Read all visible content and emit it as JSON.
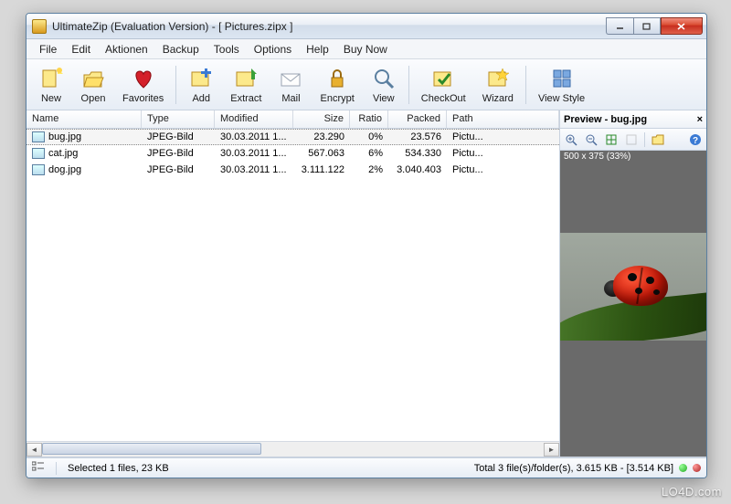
{
  "title": "UltimateZip (Evaluation Version) - [ Pictures.zipx ]",
  "menu": [
    "File",
    "Edit",
    "Aktionen",
    "Backup",
    "Tools",
    "Options",
    "Help",
    "Buy Now"
  ],
  "toolbar": [
    {
      "id": "new",
      "label": "New"
    },
    {
      "id": "open",
      "label": "Open"
    },
    {
      "id": "favorites",
      "label": "Favorites"
    },
    {
      "id": "add",
      "label": "Add"
    },
    {
      "id": "extract",
      "label": "Extract"
    },
    {
      "id": "mail",
      "label": "Mail"
    },
    {
      "id": "encrypt",
      "label": "Encrypt"
    },
    {
      "id": "view",
      "label": "View"
    },
    {
      "id": "checkout",
      "label": "CheckOut"
    },
    {
      "id": "wizard",
      "label": "Wizard"
    },
    {
      "id": "viewstyle",
      "label": "View Style"
    }
  ],
  "columns": {
    "name": "Name",
    "type": "Type",
    "modified": "Modified",
    "size": "Size",
    "ratio": "Ratio",
    "packed": "Packed",
    "path": "Path"
  },
  "files": [
    {
      "name": "bug.jpg",
      "type": "JPEG-Bild",
      "modified": "30.03.2011 1...",
      "size": "23.290",
      "ratio": "0%",
      "packed": "23.576",
      "path": "Pictu...",
      "selected": true
    },
    {
      "name": "cat.jpg",
      "type": "JPEG-Bild",
      "modified": "30.03.2011 1...",
      "size": "567.063",
      "ratio": "6%",
      "packed": "534.330",
      "path": "Pictu...",
      "selected": false
    },
    {
      "name": "dog.jpg",
      "type": "JPEG-Bild",
      "modified": "30.03.2011 1...",
      "size": "3.111.122",
      "ratio": "2%",
      "packed": "3.040.403",
      "path": "Pictu...",
      "selected": false
    }
  ],
  "preview": {
    "title": "Preview - bug.jpg",
    "info": "500 x 375 (33%)"
  },
  "status": {
    "selected": "Selected 1 files, 23 KB",
    "total": "Total 3 file(s)/folder(s), 3.615 KB - [3.514 KB]"
  },
  "watermark": "LO4D.com"
}
